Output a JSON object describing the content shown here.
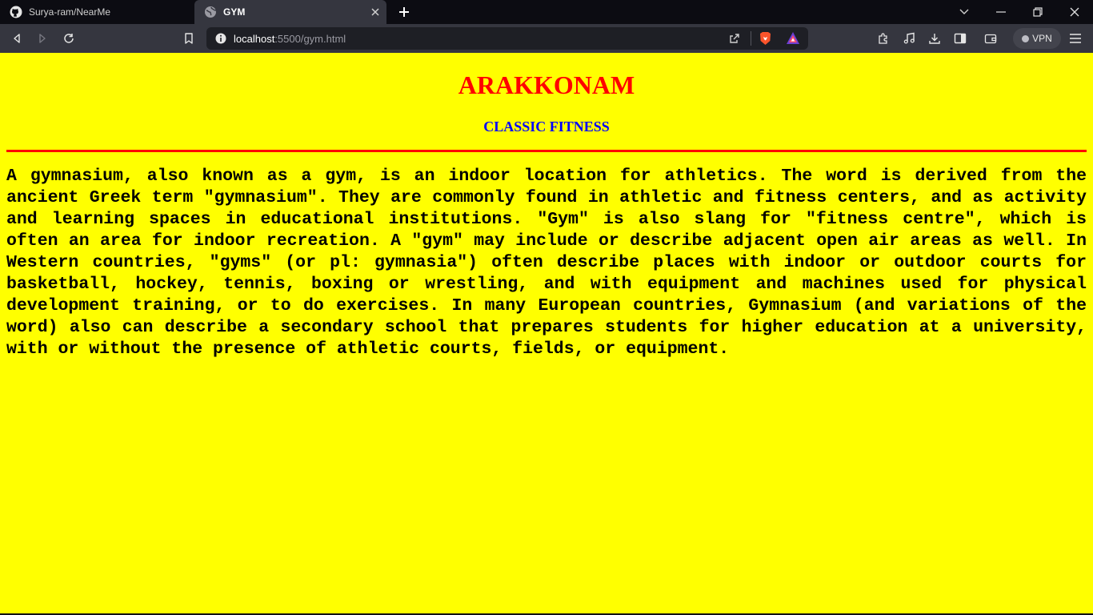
{
  "browser": {
    "tabs": [
      {
        "title": "Surya-ram/NearMe",
        "icon": "github-icon",
        "active": false
      },
      {
        "title": "GYM",
        "icon": "globe-icon",
        "active": true
      }
    ],
    "address": {
      "host": "localhost",
      "rest": ":5500/gym.html"
    },
    "vpn_label": "VPN",
    "colors": {
      "tabstrip": "#0c0c12",
      "toolbar": "#35363f",
      "urlbar": "#1e1f25"
    }
  },
  "page": {
    "heading": "ARAKKONAM",
    "subheading": "CLASSIC FITNESS",
    "paragraph": "A gymnasium, also known as a gym, is an indoor location for athletics. The word is derived from the ancient Greek term \"gymnasium\". They are commonly found in athletic and fitness centers, and as activity and learning spaces in educational institutions. \"Gym\" is also slang for \"fitness centre\", which is often an area for indoor recreation. A \"gym\" may include or describe adjacent open air areas as well. In Western countries, \"gyms\" (or pl: gymnasia\") often describe places with indoor or outdoor courts for basketball, hockey, tennis, boxing or wrestling, and with equipment and machines used for physical development training, or to do exercises. In many European countries, Gymnasium (and variations of the word) also can describe a secondary school that prepares students for higher education at a university, with or without the presence of athletic courts, fields, or equipment.",
    "colors": {
      "background": "#ffff00",
      "heading": "#ff0000",
      "subheading": "#0000ff",
      "rule": "#ff0000",
      "text": "#000000"
    }
  }
}
